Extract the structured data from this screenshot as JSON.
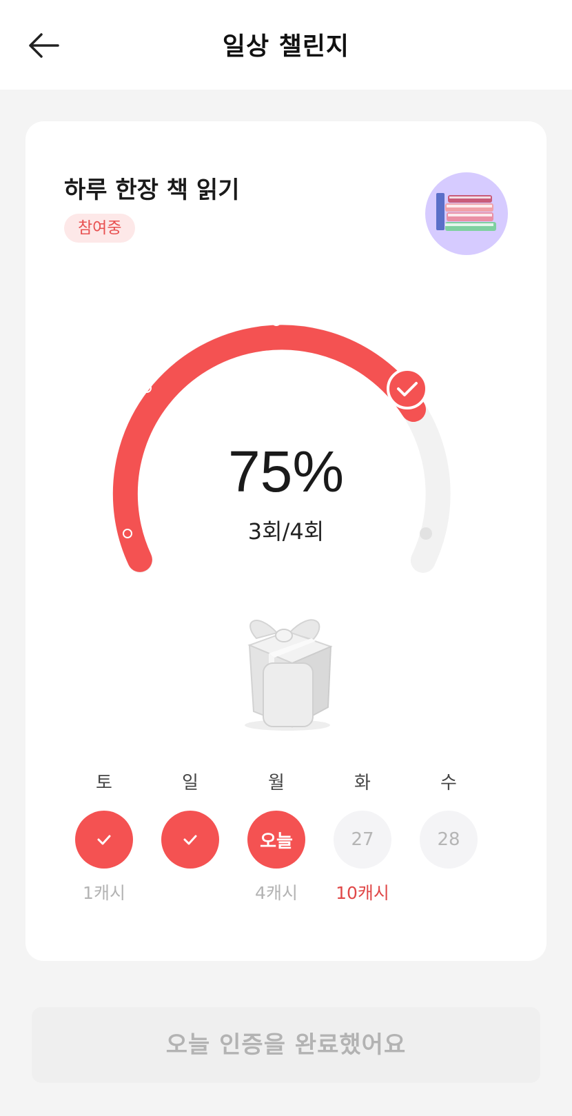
{
  "header": {
    "title": "일상 챌린지",
    "back_icon": "arrow-left-icon"
  },
  "challenge": {
    "title": "하루 한장 책 읽기",
    "status": "참여중",
    "icon": "books-icon"
  },
  "progress": {
    "percent_label": "75%",
    "percent_value": 0.75,
    "count_label": "3회/4회",
    "completed": 3,
    "total": 4
  },
  "reward_icon": "gift-box-icon",
  "days": [
    {
      "label": "토",
      "state": "done",
      "text": "",
      "reward": "1캐시",
      "highlight": false
    },
    {
      "label": "일",
      "state": "done",
      "text": "",
      "reward": "",
      "highlight": false
    },
    {
      "label": "월",
      "state": "today",
      "text": "오늘",
      "reward": "4캐시",
      "highlight": false
    },
    {
      "label": "화",
      "state": "future",
      "text": "27",
      "reward": "10캐시",
      "highlight": true
    },
    {
      "label": "수",
      "state": "future",
      "text": "28",
      "reward": "",
      "highlight": false
    }
  ],
  "footer": {
    "button_label": "오늘 인증을 완료했어요"
  },
  "colors": {
    "accent": "#f45252",
    "badge_bg": "#fde8e8",
    "track": "#f0f0f0",
    "icon_bg": "#d6cbff"
  }
}
